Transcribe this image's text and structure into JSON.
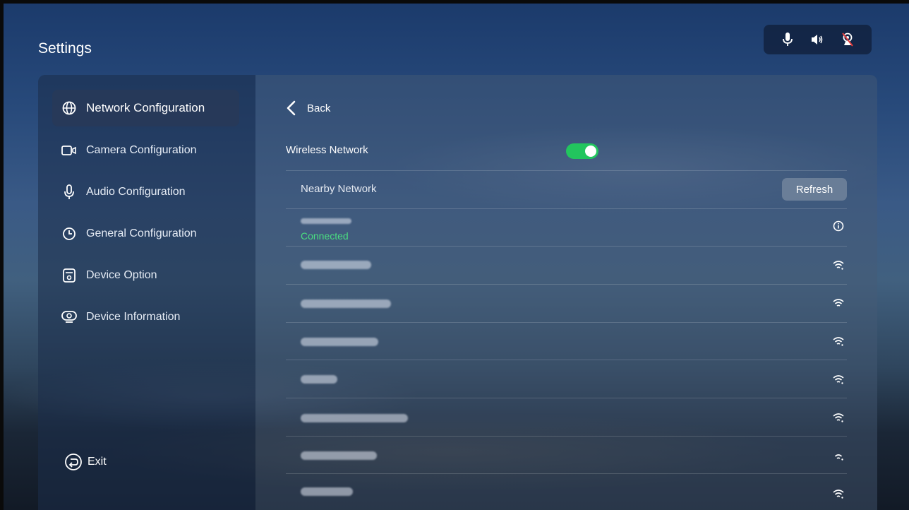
{
  "header": {
    "title": "Settings"
  },
  "status_icons": [
    "microphone-icon",
    "speaker-icon",
    "camera-off-icon"
  ],
  "sidebar": {
    "items": [
      {
        "label": "Network Configuration",
        "icon": "globe-icon",
        "active": true
      },
      {
        "label": "Camera Configuration",
        "icon": "camera-icon",
        "active": false
      },
      {
        "label": "Audio Configuration",
        "icon": "microphone-icon",
        "active": false
      },
      {
        "label": "General Configuration",
        "icon": "clock-icon",
        "active": false
      },
      {
        "label": "Device Option",
        "icon": "device-icon",
        "active": false
      },
      {
        "label": "Device Information",
        "icon": "info-device-icon",
        "active": false
      }
    ],
    "exit_label": "Exit"
  },
  "content": {
    "back_label": "Back",
    "wireless_label": "Wireless Network",
    "wireless_enabled": true,
    "nearby_label": "Nearby Network",
    "refresh_label": "Refresh",
    "connected_status": "Connected",
    "accent_color": "#22c55e"
  }
}
